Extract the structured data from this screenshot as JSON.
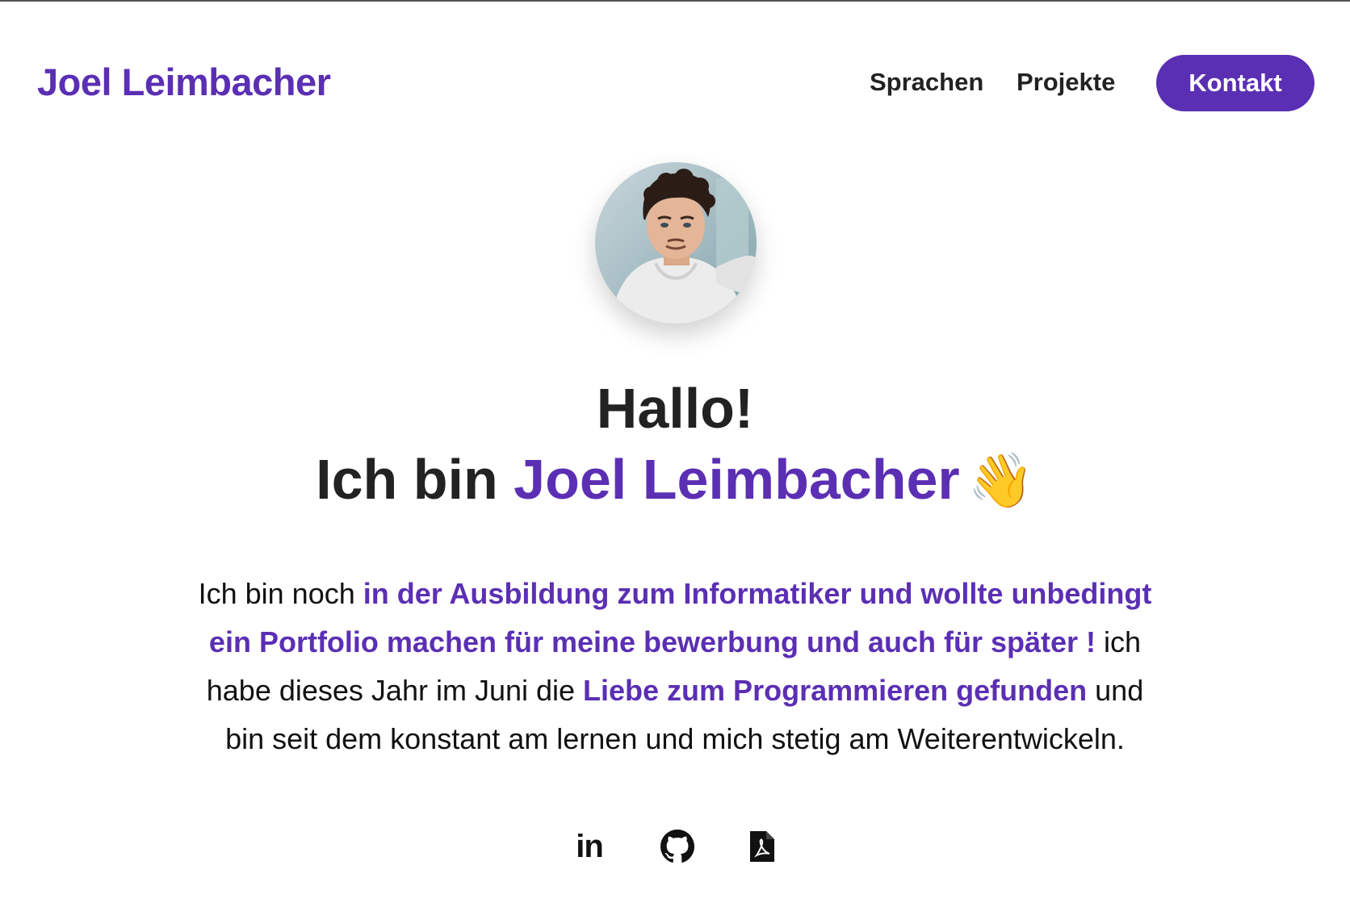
{
  "header": {
    "brand": "Joel Leimbacher",
    "nav": {
      "sprachen": "Sprachen",
      "projekte": "Projekte",
      "kontakt": "Kontakt"
    }
  },
  "hero": {
    "greeting": "Hallo!",
    "intro_prefix": "Ich bin ",
    "intro_name": "Joel Leimbacher",
    "wave_emoji": "👋"
  },
  "bio": {
    "p1": "Ich bin noch ",
    "h1": "in der Ausbildung zum Informatiker und wollte unbedingt ein Portfolio machen für meine bewerbung und auch für später !",
    "p2": " ich habe dieses Jahr im Juni die ",
    "h2": "Liebe zum Programmieren gefunden",
    "p3": " und bin seit dem konstant am lernen und mich stetig am Weiterentwickeln."
  },
  "socials": {
    "linkedin_label": "in",
    "icons": [
      "linkedin-icon",
      "github-icon",
      "pdf-icon"
    ]
  },
  "colors": {
    "accent": "#5b2fb3",
    "text": "#222222",
    "background": "#ffffff"
  }
}
